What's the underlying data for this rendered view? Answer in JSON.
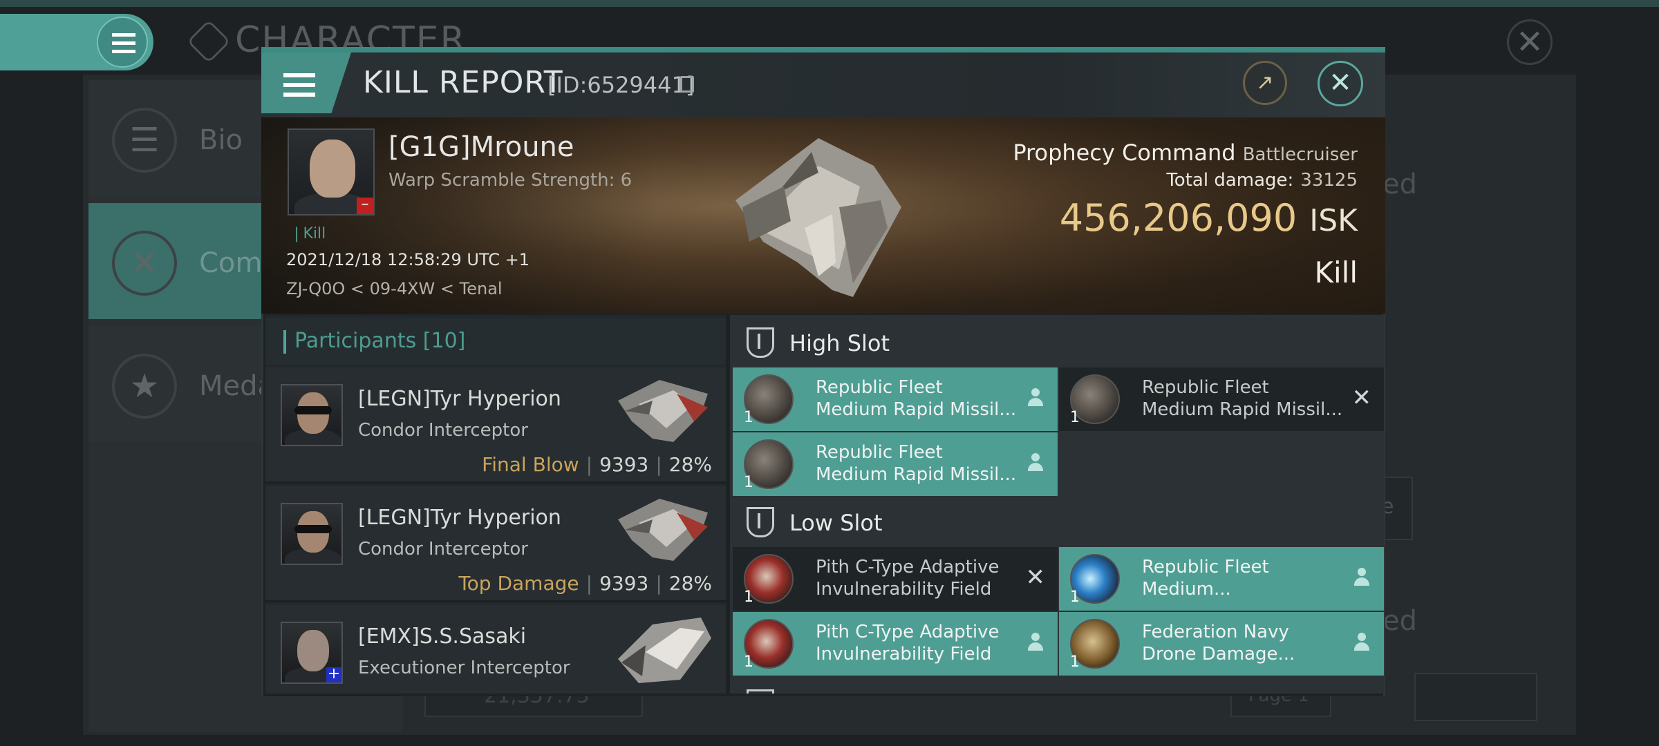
{
  "background": {
    "title": "CHARACTER",
    "nav": [
      {
        "label": "Bio"
      },
      {
        "label": "Comb"
      },
      {
        "label": "Meda"
      }
    ],
    "right_fragments": [
      "ed",
      "e",
      "ed"
    ],
    "bottom_value": "21,357.75",
    "page_label": "Page 1"
  },
  "dialog": {
    "title": "KILL REPORT",
    "id_text": "[ID:6529441]",
    "victim": {
      "name": "[G1G]Mroune",
      "subtitle": "Warp Scramble Strength: 6",
      "badge": "Kill",
      "datetime": "2021/12/18 12:58:29 UTC +1",
      "location": "ZJ-Q0O < 09-4XW < Tenal"
    },
    "ship": {
      "name": "Prophecy Command",
      "class": "Battlecruiser",
      "total_damage_label": "Total damage:",
      "total_damage": "33125",
      "isk_value": "456,206,090",
      "isk_unit": "ISK",
      "result": "Kill"
    },
    "participants": {
      "label": "Participants",
      "count": "[10]",
      "rows": [
        {
          "name": "[LEGN]Tyr Hyperion",
          "ship": "Condor Interceptor",
          "role": "Final Blow",
          "damage": "9393",
          "percent": "28%"
        },
        {
          "name": "[LEGN]Tyr Hyperion",
          "ship": "Condor Interceptor",
          "role": "Top Damage",
          "damage": "9393",
          "percent": "28%"
        },
        {
          "name": "[EMX]S.S.Sasaki",
          "ship": "Executioner Interceptor",
          "role": "",
          "damage": "",
          "percent": ""
        }
      ]
    },
    "slots": {
      "high": {
        "label": "High Slot",
        "modules": [
          {
            "line1": "Republic Fleet",
            "line2": "Medium Rapid Missil...",
            "qty": "1",
            "state": "fitted"
          },
          {
            "line1": "Republic Fleet",
            "line2": "Medium Rapid Missil...",
            "qty": "1",
            "state": "destroyed"
          },
          {
            "line1": "Republic Fleet",
            "line2": "Medium Rapid Missil...",
            "qty": "1",
            "state": "fitted"
          }
        ]
      },
      "low": {
        "label": "Low Slot",
        "modules": [
          {
            "line1": "Pith C-Type Adaptive",
            "line2": "Invulnerability Field",
            "qty": "1",
            "state": "destroyed"
          },
          {
            "line1": "Republic Fleet",
            "line2": "Medium...",
            "qty": "1",
            "state": "fitted"
          },
          {
            "line1": "Pith C-Type Adaptive",
            "line2": "Invulnerability Field",
            "qty": "1",
            "state": "fitted"
          },
          {
            "line1": "Federation Navy",
            "line2": "Drone Damage...",
            "qty": "1",
            "state": "fitted"
          }
        ]
      }
    }
  },
  "colors": {
    "accent": "#4f9e93",
    "isk": "#e8c98a",
    "role": "#c9a45e"
  },
  "icons": [
    "menu-icon",
    "share-icon",
    "close-icon",
    "copy-icon",
    "slot-icon",
    "pilot-icon",
    "destroyed-x-icon"
  ]
}
